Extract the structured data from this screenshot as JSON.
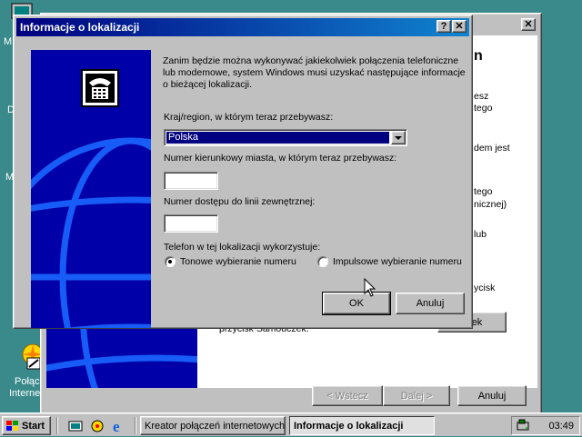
{
  "desktop": {
    "icon_labels": {
      "my_computer": "M",
      "docs": "D",
      "network": "M",
      "connect_internet_line1": "Połącz",
      "connect_internet_line2": "Internet"
    }
  },
  "wizard": {
    "close_symbol": "✕",
    "text_fragments": [
      "n",
      "esz",
      "tego",
      "dem jest",
      "tego",
      "nicznej)",
      "lub",
      "ycisk",
      "przycisk Samouczek."
    ],
    "tutorial_label": "czek",
    "back_label": "< Wstecz",
    "next_label": "Dalej >",
    "cancel_label": "Anuluj"
  },
  "dialog": {
    "title": "Informacje o lokalizacji",
    "help_symbol": "?",
    "close_symbol": "✕",
    "intro_text": "Zanim będzie można wykonywać jakiekolwiek połączenia telefoniczne lub modemowe, system Windows musi uzyskać następujące informacje o bieżącej lokalizacji.",
    "country": {
      "label": "Kraj/region, w którym teraz przebywasz:",
      "value": "Polska"
    },
    "area_code": {
      "label": "Numer kierunkowy miasta, w którym teraz przebywasz:",
      "value": ""
    },
    "outside_line": {
      "label": "Numer dostępu do linii zewnętrznej:",
      "value": ""
    },
    "dialing": {
      "label": "Telefon w tej lokalizacji wykorzystuje:",
      "options": [
        "Tonowe wybieranie numeru",
        "Impulsowe wybieranie numeru"
      ],
      "selected": "Tonowe wybieranie numeru"
    },
    "ok_label": "OK",
    "cancel_label": "Anuluj"
  },
  "taskbar": {
    "start_label": "Start",
    "tasks": [
      "Kreator połączeń internetowych",
      "Informacje o lokalizacji"
    ],
    "active_task": "Informacje o lokalizacji",
    "clock": "03:49"
  },
  "colors": {
    "desktop": "#3a8a8c",
    "title_active": "#000080",
    "art_blue": "#0000a8",
    "face": "#c0c0c0"
  }
}
